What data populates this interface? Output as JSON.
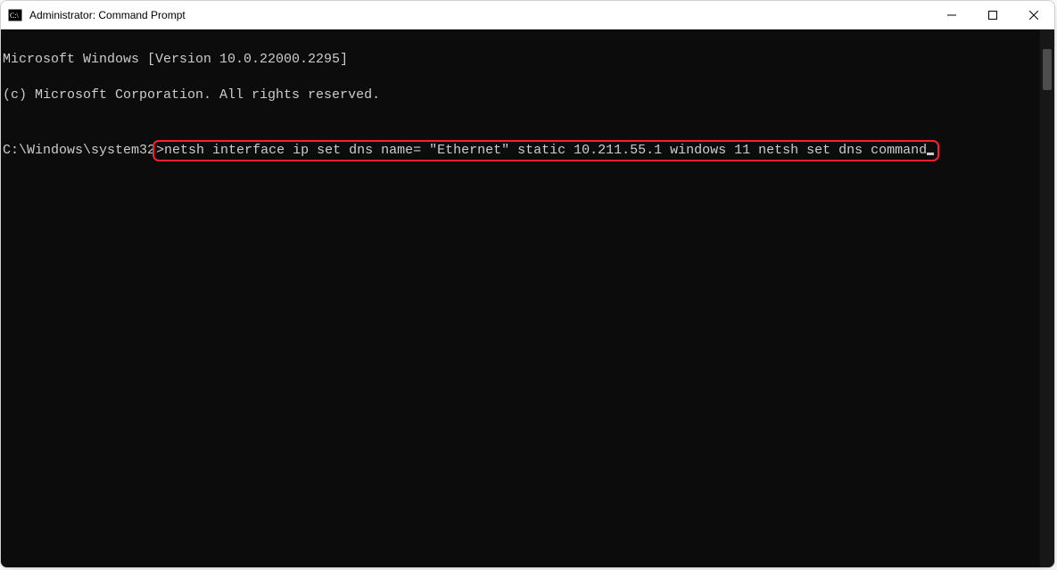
{
  "window": {
    "title": "Administrator: Command Prompt"
  },
  "console": {
    "line1": "Microsoft Windows [Version 10.0.22000.2295]",
    "line2": "(c) Microsoft Corporation. All rights reserved.",
    "blank": "",
    "prompt_prefix": "C:\\Windows\\system32",
    "prompt_angle": ">",
    "command": "netsh interface ip set dns name= \"Ethernet\" static 10.211.55.1 windows 11 netsh set dns command"
  }
}
